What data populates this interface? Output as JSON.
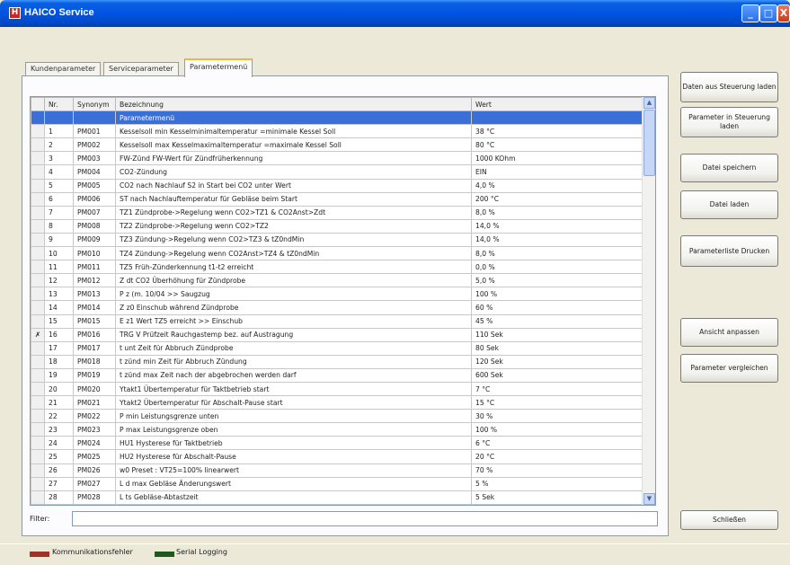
{
  "window": {
    "app_icon": "H",
    "title": "HAICO Service",
    "controls": {
      "minimize": "_",
      "maximize": "□",
      "close": "X"
    }
  },
  "tabs": [
    {
      "label": "Kundenparameter"
    },
    {
      "label": "Serviceparameter"
    },
    {
      "label": "Parametermenü"
    }
  ],
  "table": {
    "columns": [
      "",
      "Nr.",
      "Synonym",
      "Bezeichnung",
      "Wert"
    ],
    "rows": [
      {
        "marker": "",
        "nr": "",
        "syn": "",
        "bez": "Parametermenü",
        "wert": "",
        "highlight": true
      },
      {
        "marker": "",
        "nr": "1",
        "syn": "PM001",
        "bez": "Kesselsoll min Kesselminimaltemperatur =minimale Kessel Soll",
        "wert": "38 °C"
      },
      {
        "marker": "",
        "nr": "2",
        "syn": "PM002",
        "bez": "Kesselsoll max Kesselmaximaltemperatur =maximale Kessel Soll",
        "wert": "80 °C"
      },
      {
        "marker": "",
        "nr": "3",
        "syn": "PM003",
        "bez": "FW-Zünd FW-Wert für Zündfrüherkennung",
        "wert": "1000 KOhm"
      },
      {
        "marker": "",
        "nr": "4",
        "syn": "PM004",
        "bez": "CO2-Zündung",
        "wert": "EIN"
      },
      {
        "marker": "",
        "nr": "5",
        "syn": "PM005",
        "bez": "CO2 nach Nachlauf S2 in Start bei CO2 unter Wert",
        "wert": "4,0 %"
      },
      {
        "marker": "",
        "nr": "6",
        "syn": "PM006",
        "bez": "ST nach Nachlauftemperatur für Gebläse beim Start",
        "wert": "200 °C"
      },
      {
        "marker": "",
        "nr": "7",
        "syn": "PM007",
        "bez": "TZ1 Zündprobe->Regelung wenn CO2>TZ1 & CO2Anst>Zdt",
        "wert": "8,0 %"
      },
      {
        "marker": "",
        "nr": "8",
        "syn": "PM008",
        "bez": "TZ2 Zündprobe->Regelung wenn CO2>TZ2",
        "wert": "14,0 %"
      },
      {
        "marker": "",
        "nr": "9",
        "syn": "PM009",
        "bez": "TZ3 Zündung->Regelung wenn CO2>TZ3 & tZ0ndMin",
        "wert": "14,0 %"
      },
      {
        "marker": "",
        "nr": "10",
        "syn": "PM010",
        "bez": "TZ4 Zündung->Regelung wenn CO2Anst>TZ4 & tZ0ndMin",
        "wert": "8,0 %"
      },
      {
        "marker": "",
        "nr": "11",
        "syn": "PM011",
        "bez": "TZ5 Früh-Zünderkennung t1-t2 erreicht",
        "wert": "0,0 %"
      },
      {
        "marker": "",
        "nr": "12",
        "syn": "PM012",
        "bez": "Z dt CO2 Überhöhung für Zündprobe",
        "wert": "5,0 %"
      },
      {
        "marker": "",
        "nr": "13",
        "syn": "PM013",
        "bez": "P z (m. 10/04 >> Saugzug",
        "wert": "100 %"
      },
      {
        "marker": "",
        "nr": "14",
        "syn": "PM014",
        "bez": "Z z0 Einschub während Zündprobe",
        "wert": "60 %"
      },
      {
        "marker": "",
        "nr": "15",
        "syn": "PM015",
        "bez": "E z1 Wert TZ5 erreicht >> Einschub",
        "wert": "45 %"
      },
      {
        "marker": "✗",
        "nr": "16",
        "syn": "PM016",
        "bez": "TRG V Prüfzeit Rauchgastemp bez. auf Austragung",
        "wert": "110 Sek"
      },
      {
        "marker": "",
        "nr": "17",
        "syn": "PM017",
        "bez": "t unt Zeit für Abbruch Zündprobe",
        "wert": "80 Sek"
      },
      {
        "marker": "",
        "nr": "18",
        "syn": "PM018",
        "bez": "t zünd min Zeit für Abbruch Zündung",
        "wert": "120 Sek"
      },
      {
        "marker": "",
        "nr": "19",
        "syn": "PM019",
        "bez": "t zünd max Zeit nach der abgebrochen werden darf",
        "wert": "600 Sek"
      },
      {
        "marker": "",
        "nr": "20",
        "syn": "PM020",
        "bez": "Ytakt1 Übertemperatur für Taktbetrieb start",
        "wert": "7 °C"
      },
      {
        "marker": "",
        "nr": "21",
        "syn": "PM021",
        "bez": "Ytakt2 Übertemperatur für Abschalt-Pause start",
        "wert": "15 °C"
      },
      {
        "marker": "",
        "nr": "22",
        "syn": "PM022",
        "bez": "P min Leistungsgrenze unten",
        "wert": "30 %"
      },
      {
        "marker": "",
        "nr": "23",
        "syn": "PM023",
        "bez": "P max Leistungsgrenze oben",
        "wert": "100 %"
      },
      {
        "marker": "",
        "nr": "24",
        "syn": "PM024",
        "bez": "HU1 Hysterese für Taktbetrieb",
        "wert": "6 °C"
      },
      {
        "marker": "",
        "nr": "25",
        "syn": "PM025",
        "bez": "HU2 Hysterese für Abschalt-Pause",
        "wert": "20 °C"
      },
      {
        "marker": "",
        "nr": "26",
        "syn": "PM026",
        "bez": "w0 Preset : VT25=100% linearwert",
        "wert": "70 %"
      },
      {
        "marker": "",
        "nr": "27",
        "syn": "PM027",
        "bez": "L d max Gebläse Änderungswert",
        "wert": "5 %"
      },
      {
        "marker": "",
        "nr": "28",
        "syn": "PM028",
        "bez": "L ts Gebläse-Abtastzeit",
        "wert": "5 Sek"
      }
    ]
  },
  "filter": {
    "label": "Filter:",
    "value": ""
  },
  "buttons": {
    "daten_laden": "Daten aus Steuerung laden",
    "parameter_laden": "Parameter in Steuerung laden",
    "datei_speichern": "Datei speichern",
    "datei_laden": "Datei laden",
    "parameterliste_drucken": "Parameterliste Drucken",
    "ansicht_anpassen": "Ansicht anpassen",
    "parameter_vergleichen": "Parameter vergleichen",
    "schliessen": "Schließen"
  },
  "status": {
    "legend": [
      {
        "label": "Kommunikationsfehler",
        "color": "#a0322a"
      },
      {
        "label": "Serial Logging",
        "color": "#1e5a1e"
      }
    ]
  }
}
